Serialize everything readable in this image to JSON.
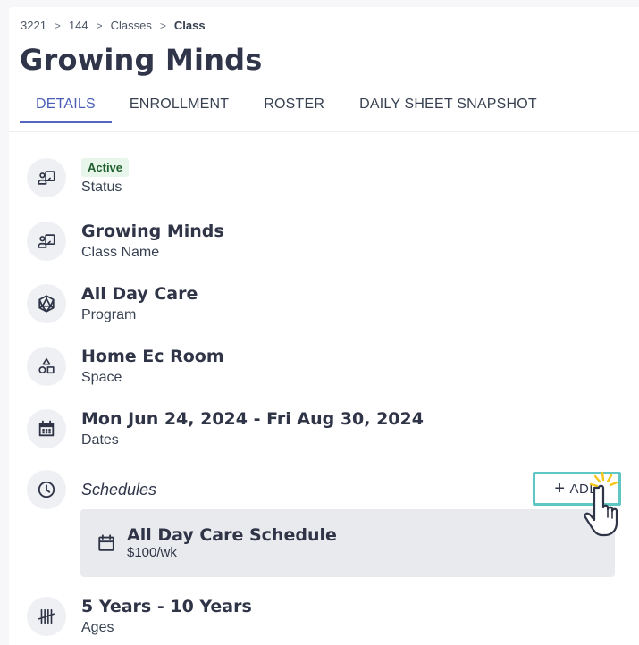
{
  "breadcrumb": {
    "items": [
      "3221",
      "144",
      "Classes"
    ],
    "current": "Class",
    "separator": ">"
  },
  "page_title": "Growing Minds",
  "tabs": [
    {
      "label": "DETAILS",
      "active": true
    },
    {
      "label": "ENROLLMENT",
      "active": false
    },
    {
      "label": "ROSTER",
      "active": false
    },
    {
      "label": "DAILY SHEET SNAPSHOT",
      "active": false
    }
  ],
  "details": {
    "status": {
      "badge": "Active",
      "label": "Status",
      "icon": "classroom-icon"
    },
    "class_name": {
      "value": "Growing Minds",
      "label": "Class Name",
      "icon": "classroom-icon"
    },
    "program": {
      "value": "All Day Care",
      "label": "Program",
      "icon": "polyhedron-icon"
    },
    "space": {
      "value": "Home Ec Room",
      "label": "Space",
      "icon": "shapes-icon"
    },
    "dates": {
      "value": "Mon Jun 24, 2024 - Fri Aug 30, 2024",
      "label": "Dates",
      "icon": "calendar-icon"
    },
    "schedules": {
      "title": "Schedules",
      "icon": "clock-icon",
      "add_label": "ADD",
      "items": [
        {
          "name": "All Day Care Schedule",
          "price": "$100/wk",
          "icon": "calendar-blank-icon"
        }
      ]
    },
    "ages": {
      "value": "5 Years - 10 Years",
      "label": "Ages",
      "icon": "tally-icon"
    }
  },
  "colors": {
    "accent": "#5465c3",
    "add_button_border": "#5ec7c3",
    "badge_bg": "#e8f5ea",
    "badge_text": "#1e5f2d"
  }
}
